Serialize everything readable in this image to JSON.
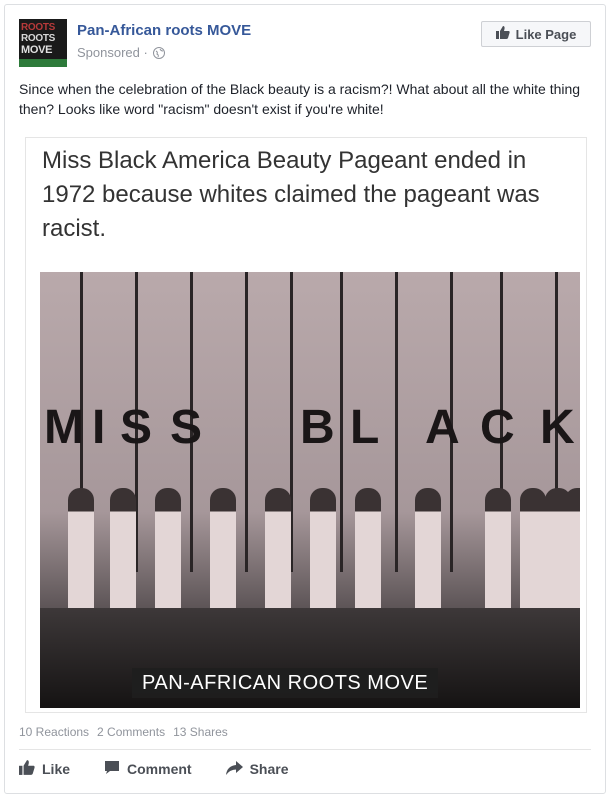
{
  "page": {
    "name": "Pan-African roots MOVE",
    "sponsored": "Sponsored ·",
    "avatar_lines": [
      "ROOTS",
      "ROOTS",
      "MOVE"
    ],
    "like_page_label": "Like Page"
  },
  "post": {
    "text": "Since when the celebration of the Black beauty is a racism?! What about all the white thing then? Looks like word \"racism\" doesn't exist if you're white!"
  },
  "image": {
    "caption": "Miss Black America Beauty Pageant ended in 1972 because whites claimed the pageant was racist.",
    "banner_letters": [
      "M",
      "I",
      "S",
      "S",
      "B",
      "L",
      "A",
      "C",
      "K"
    ],
    "watermark": "PAN-AFRICAN ROOTS MOVE"
  },
  "stats": {
    "reactions": "10 Reactions",
    "comments": "2 Comments",
    "shares": "13 Shares"
  },
  "actions": {
    "like": "Like",
    "comment": "Comment",
    "share": "Share"
  },
  "colors": {
    "link_blue": "#365899",
    "meta_gray": "#90949c",
    "action_gray": "#4b4f56",
    "border": "#dddfe2"
  },
  "icons": [
    "globe-icon",
    "thumbs-up-icon",
    "comment-icon",
    "share-icon"
  ]
}
